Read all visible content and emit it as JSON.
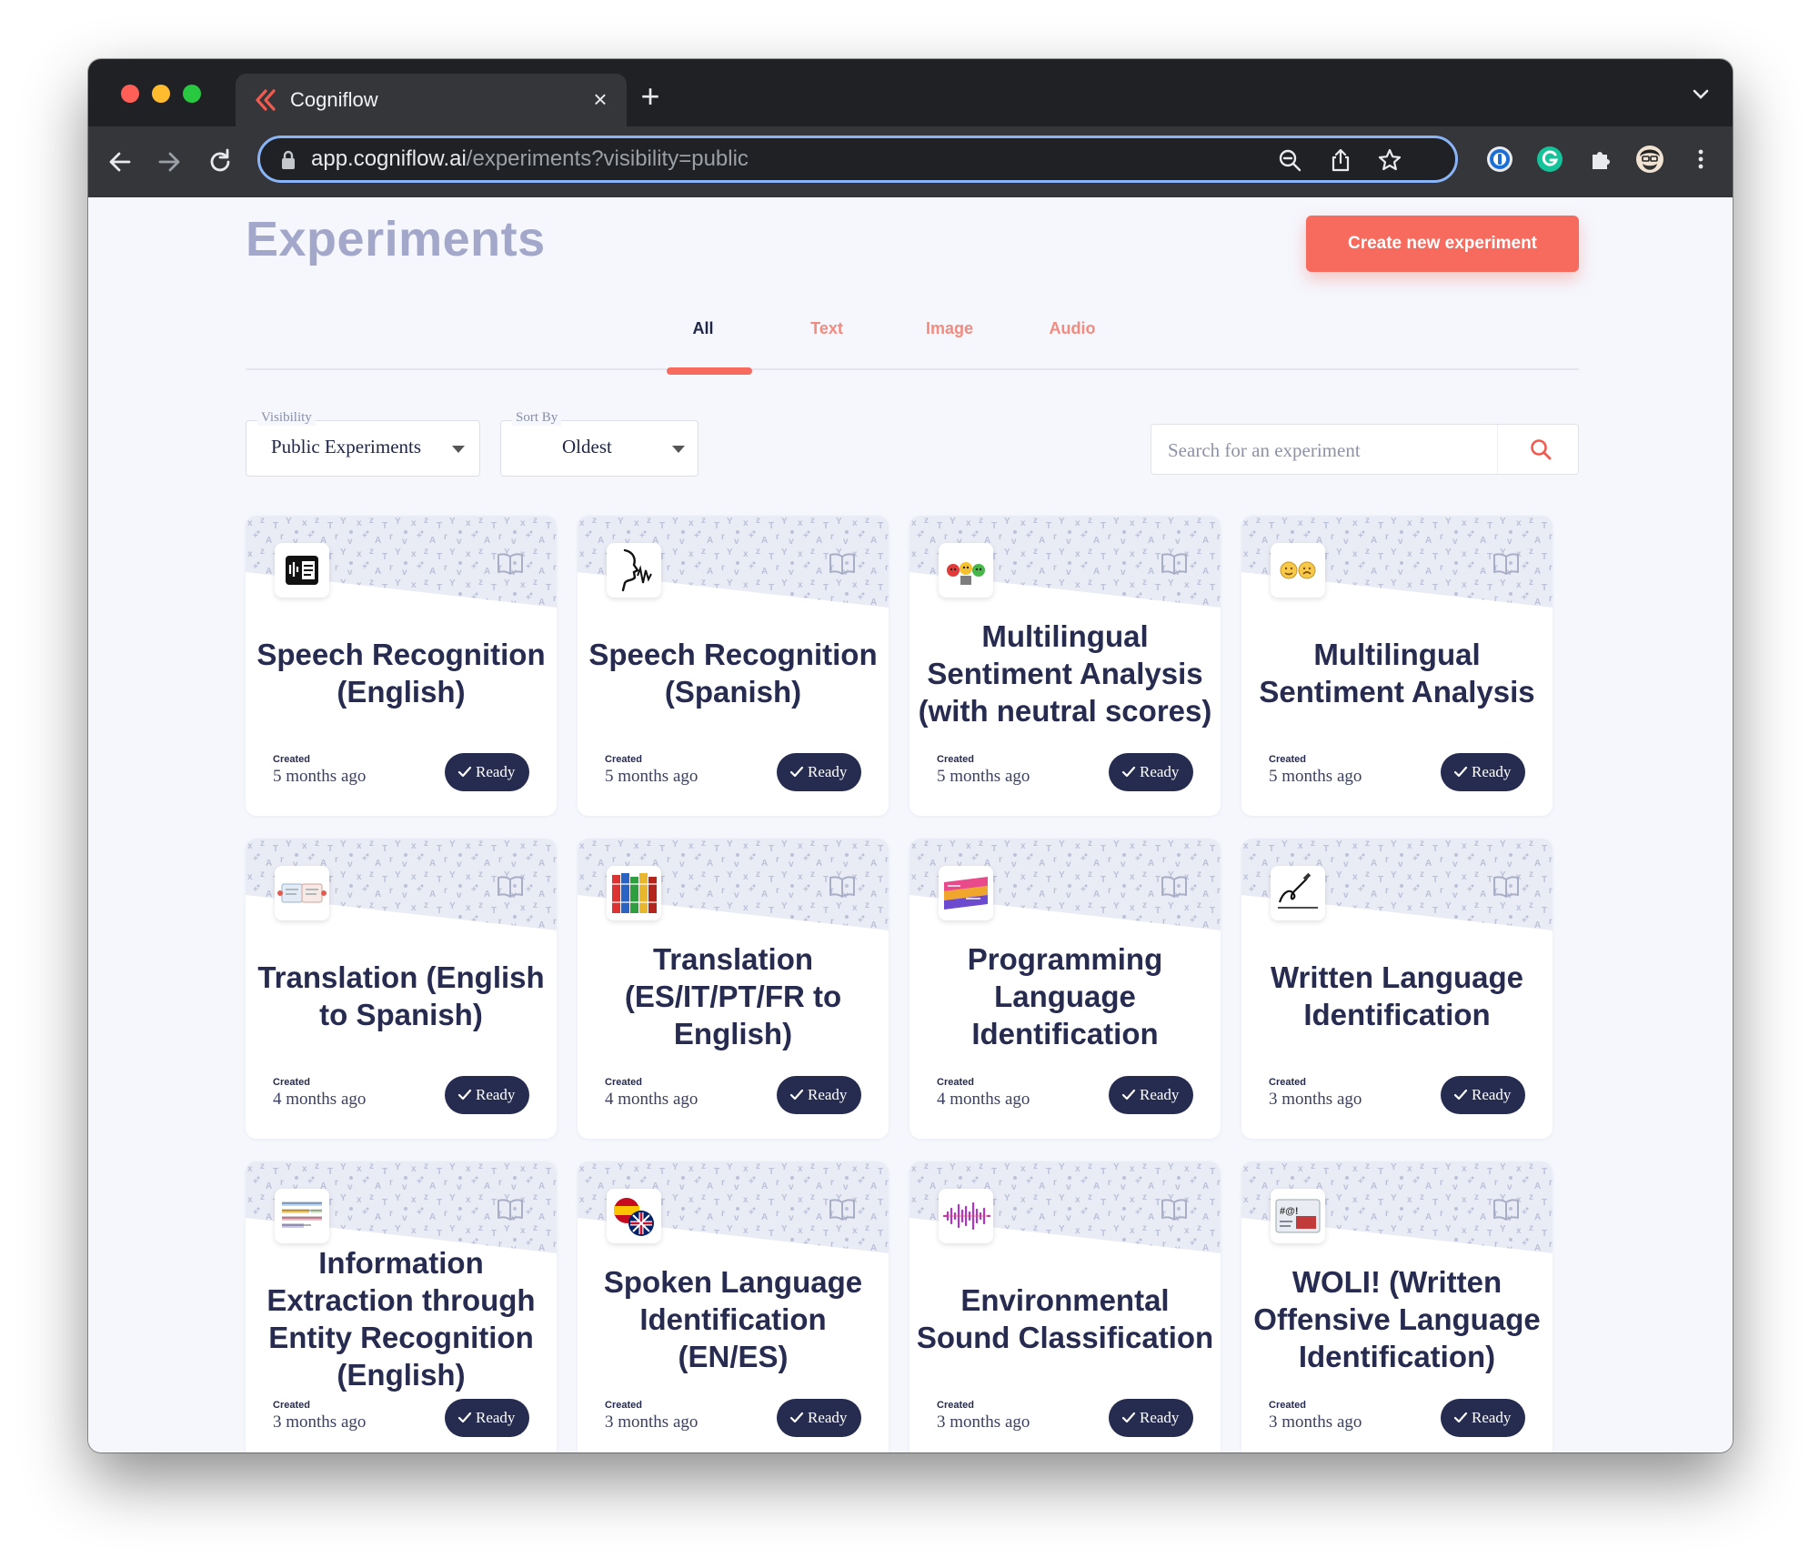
{
  "browser": {
    "tab_title": "Cogniflow",
    "url_host": "app.cogniflow.ai",
    "url_path": "/experiments?visibility=public",
    "accent": "#8ab4f8"
  },
  "page": {
    "title": "Experiments",
    "create_button": "Create new experiment",
    "accent": "#f76b5e",
    "tabs": [
      {
        "label": "All",
        "active": true
      },
      {
        "label": "Text",
        "active": false
      },
      {
        "label": "Image",
        "active": false
      },
      {
        "label": "Audio",
        "active": false
      }
    ],
    "filters": {
      "visibility_label": "Visibility",
      "visibility_value": "Public Experiments",
      "sort_label": "Sort By",
      "sort_value": "Oldest"
    },
    "search": {
      "placeholder": "Search for an experiment"
    }
  },
  "cards": [
    {
      "title": "Speech Recognition (English)",
      "created_label": "Created",
      "created": "5 months ago",
      "status": "Ready",
      "icon": "speech-text-icon"
    },
    {
      "title": "Speech Recognition (Spanish)",
      "created_label": "Created",
      "created": "5 months ago",
      "status": "Ready",
      "icon": "speaking-head-icon"
    },
    {
      "title": "Multilingual Sentiment Analysis (with neutral scores)",
      "created_label": "Created",
      "created": "5 months ago",
      "status": "Ready",
      "icon": "traffic-faces-icon"
    },
    {
      "title": "Multilingual Sentiment Analysis",
      "created_label": "Created",
      "created": "5 months ago",
      "status": "Ready",
      "icon": "emoji-faces-icon"
    },
    {
      "title": "Translation (English to Spanish)",
      "created_label": "Created",
      "created": "4 months ago",
      "status": "Ready",
      "icon": "translation-icon"
    },
    {
      "title": "Translation (ES/IT/PT/FR to English)",
      "created_label": "Created",
      "created": "4 months ago",
      "status": "Ready",
      "icon": "dictionaries-icon"
    },
    {
      "title": "Programming Language Identification",
      "created_label": "Created",
      "created": "4 months ago",
      "status": "Ready",
      "icon": "code-colors-icon"
    },
    {
      "title": "Written Language Identification",
      "created_label": "Created",
      "created": "3 months ago",
      "status": "Ready",
      "icon": "handwriting-icon"
    },
    {
      "title": "Information Extraction through Entity Recognition (English)",
      "created_label": "Created",
      "created": "3 months ago",
      "status": "Ready",
      "icon": "highlighted-text-icon"
    },
    {
      "title": "Spoken Language Identification (EN/ES)",
      "created_label": "Created",
      "created": "3 months ago",
      "status": "Ready",
      "icon": "flags-icon"
    },
    {
      "title": "Environmental Sound Classification",
      "created_label": "Created",
      "created": "3 months ago",
      "status": "Ready",
      "icon": "waveform-icon"
    },
    {
      "title": "WOLI! (Written Offensive Language Identification)",
      "created_label": "Created",
      "created": "3 months ago",
      "status": "Ready",
      "icon": "offensive-text-icon"
    }
  ]
}
